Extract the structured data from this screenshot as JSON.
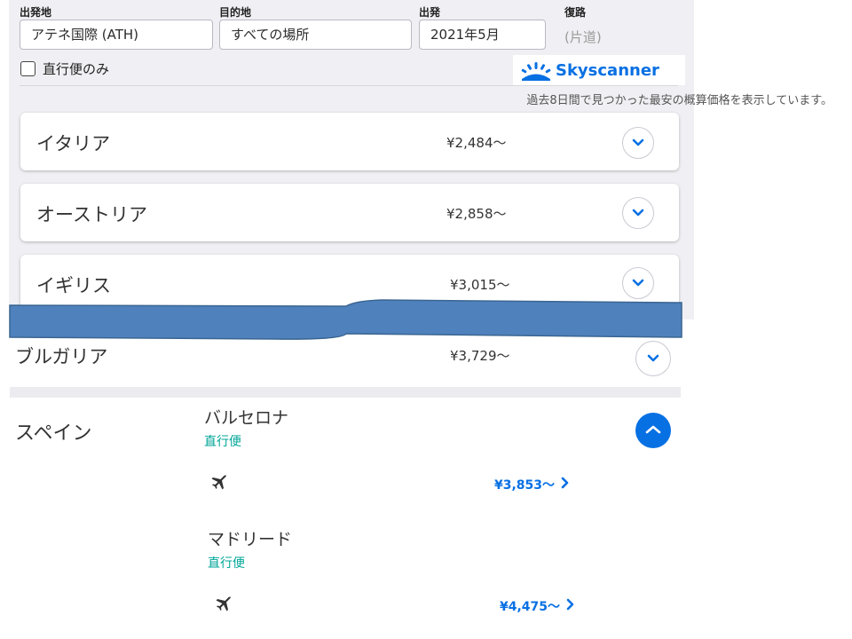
{
  "search": {
    "origin_label": "出発地",
    "origin_value": "アテネ国際 (ATH)",
    "destination_label": "目的地",
    "destination_value": "すべての場所",
    "depart_label": "出発",
    "depart_value": "2021年5月",
    "return_label": "復路",
    "return_value": "(片道)",
    "direct_only_label": "直行便のみ",
    "direct_only_checked": false
  },
  "brand": {
    "name": "Skyscanner",
    "color": "#0770e3"
  },
  "note": "過去8日間で見つかった最安の概算価格を表示しています。",
  "results": [
    {
      "country": "イタリア",
      "price": "¥2,484～",
      "expanded": false
    },
    {
      "country": "オーストリア",
      "price": "¥2,858～",
      "expanded": false
    },
    {
      "country": "イギリス",
      "price": "¥3,015～",
      "expanded": false
    },
    {
      "country": "ブルガリア",
      "price": "¥3,729～",
      "expanded": false
    }
  ],
  "expanded_country": {
    "country": "スペイン",
    "expanded": true,
    "cities": [
      {
        "city": "バルセロナ",
        "direct_label": "直行便",
        "price": "¥3,853～",
        "icon": "airplane-icon"
      },
      {
        "city": "マドリード",
        "direct_label": "直行便",
        "price": "¥4,475～",
        "icon": "airplane-icon"
      }
    ]
  },
  "colors": {
    "accent": "#0770e3",
    "direct": "#00a698",
    "ribbon": "#4f81bd",
    "panel": "#f0f0f4"
  }
}
